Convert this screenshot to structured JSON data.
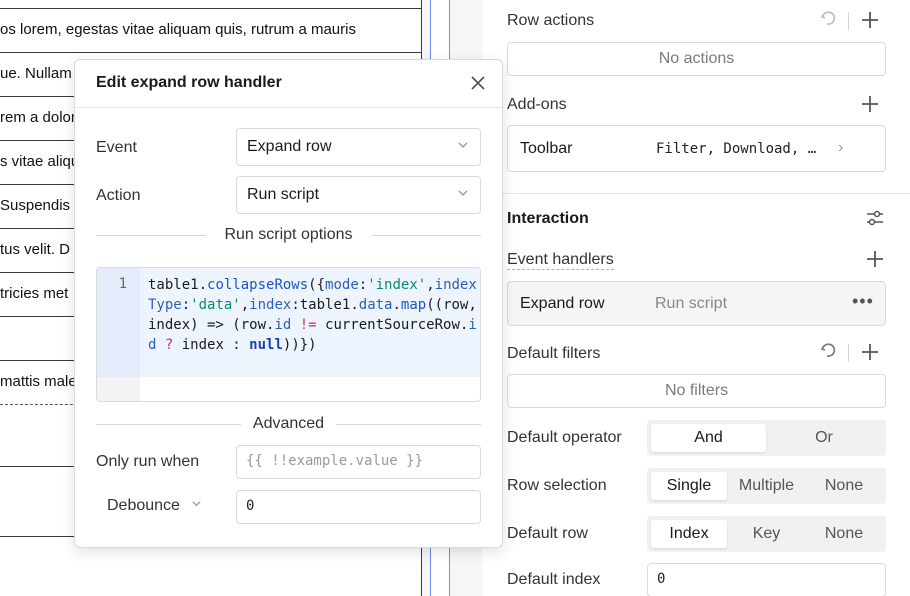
{
  "background_table": {
    "rows": [
      "os lorem, egestas vitae aliquam quis, rutrum a mauris",
      "ue. Nullam",
      "rem a dolor",
      "s vitae aliqu",
      " Suspendis",
      "tus velit. D",
      "tricies met",
      "",
      "mattis male",
      "",
      ""
    ]
  },
  "inspector": {
    "row_actions": {
      "title": "Row actions",
      "empty": "No actions"
    },
    "addons": {
      "title": "Add-ons",
      "toolbar_label": "Toolbar",
      "toolbar_value": "Filter, Download, …"
    },
    "interaction": {
      "title": "Interaction",
      "event_handlers_label": "Event handlers",
      "handler": {
        "event": "Expand row",
        "action": "Run script",
        "more": "•••"
      }
    },
    "default_filters": {
      "title": "Default filters",
      "empty": "No filters"
    },
    "default_operator": {
      "label": "Default operator",
      "options": [
        "And",
        "Or"
      ],
      "selected": "And"
    },
    "row_selection": {
      "label": "Row selection",
      "options": [
        "Single",
        "Multiple",
        "None"
      ],
      "selected": "Single"
    },
    "default_row": {
      "label": "Default row",
      "options": [
        "Index",
        "Key",
        "None"
      ],
      "selected": "Index"
    },
    "default_index": {
      "label": "Default index",
      "value": "0"
    }
  },
  "modal": {
    "title": "Edit expand row handler",
    "close_icon": "×",
    "event": {
      "label": "Event",
      "value": "Expand row"
    },
    "action": {
      "label": "Action",
      "value": "Run script"
    },
    "script_section": "Run script options",
    "code": {
      "line_number": "1",
      "t1": "table1",
      "t2": ".",
      "t3": "collapseRows",
      "t4": "({",
      "t5": "mode",
      "t6": ":",
      "t7": "'index'",
      "t8": ",",
      "t9": "indexType",
      "t10": ":",
      "t11": "'data'",
      "t12": ",",
      "t13": "index",
      "t14": ":table1.",
      "t15": "data",
      "t16": ".",
      "t17": "map",
      "t18": "((row, index) => (row.",
      "t19": "id",
      "t20": " != ",
      "t21": "currentSourceRow",
      "t22": ".",
      "t23": "id",
      "t24": " ? ",
      "t25": "index : ",
      "t26": "null",
      "t27": "))})"
    },
    "advanced_section": "Advanced",
    "only_run_when": {
      "label": "Only run when",
      "placeholder": "{{ !!example.value }}"
    },
    "debounce": {
      "label": "Debounce",
      "value": "0"
    }
  },
  "colors": {
    "accent_blue": "#6b8df5",
    "string_green": "#0a8a6b"
  },
  "icons": {
    "reset": "reset-icon",
    "add": "plus-icon",
    "settings": "sliders-icon",
    "chevron": "chevron-down-icon"
  }
}
